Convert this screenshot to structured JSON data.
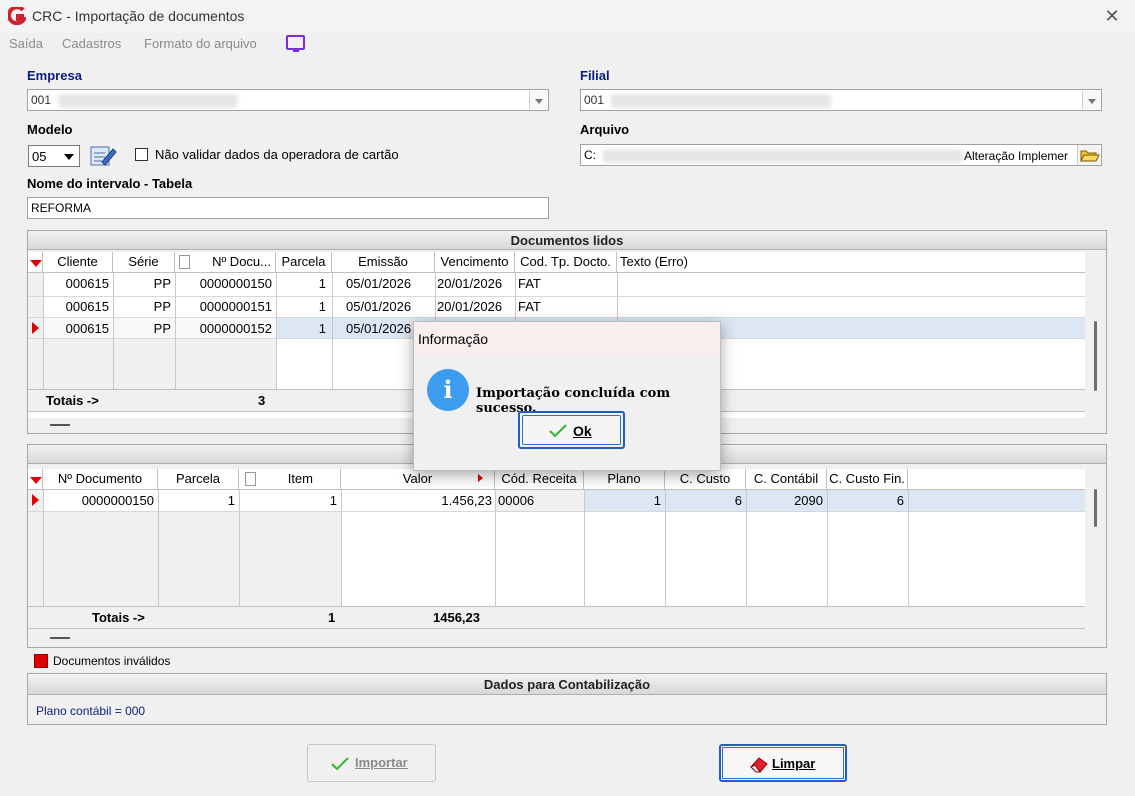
{
  "window": {
    "title": "CRC - Importação de documentos",
    "close_glyph": "✕"
  },
  "menu": {
    "items": [
      "Saída",
      "Cadastros",
      "Formato do arquivo"
    ]
  },
  "form": {
    "empresa_label": "Empresa",
    "empresa_value": "001",
    "filial_label": "Filial",
    "filial_value": "001",
    "modelo_label": "Modelo",
    "modelo_value": "05",
    "checkbox_label": "Não validar dados da operadora de cartão",
    "arquivo_label": "Arquivo",
    "arquivo_prefix": "C:",
    "arquivo_suffix": "Alteração Implemer",
    "intervalo_label": "Nome do intervalo - Tabela",
    "intervalo_value": "REFORMA"
  },
  "documentos": {
    "title": "Documentos lidos",
    "headers": [
      "Cliente",
      "Série",
      "Nº Docu...",
      "Parcela",
      "Emissão",
      "Vencimento",
      "Cod. Tp. Docto.",
      "Texto (Erro)"
    ],
    "rows": [
      [
        "000615",
        "PP",
        "0000000150",
        "1",
        "05/01/2026",
        "20/01/2026",
        "FAT",
        ""
      ],
      [
        "000615",
        "PP",
        "0000000151",
        "1",
        "05/01/2026",
        "20/01/2026",
        "FAT",
        ""
      ],
      [
        "000615",
        "PP",
        "0000000152",
        "1",
        "05/01/2026",
        "",
        "",
        ""
      ]
    ],
    "totals_label": "Totais ->",
    "totals_count": "3"
  },
  "itens": {
    "headers": [
      "Nº Documento",
      "Parcela",
      "Item",
      "Valor",
      "Cód. Receita",
      "Plano",
      "C. Custo",
      "C. Contábil",
      "C. Custo Fin."
    ],
    "rows": [
      [
        "0000000150",
        "1",
        "1",
        "1.456,23",
        "00006",
        "1",
        "6",
        "2090",
        "6"
      ]
    ],
    "totals_label": "Totais ->",
    "totals_count": "1",
    "totals_value": "1456,23"
  },
  "dialog": {
    "title": "Informação",
    "message": "Importação concluída com sucesso.",
    "ok_label": "Ok",
    "icon_glyph": "i"
  },
  "legend": {
    "label": "Documentos inválidos",
    "color": "#e00000"
  },
  "contabilizacao": {
    "title": "Dados para Contabilização",
    "plano_text": "Plano contábil = 000"
  },
  "buttons": {
    "importar_label": "Importar",
    "limpar_label": "Limpar"
  },
  "colors": {
    "accent_blue": "#0a1e7e",
    "dialog_icon": "#3b9cf0",
    "logo_red": "#d0202a"
  }
}
